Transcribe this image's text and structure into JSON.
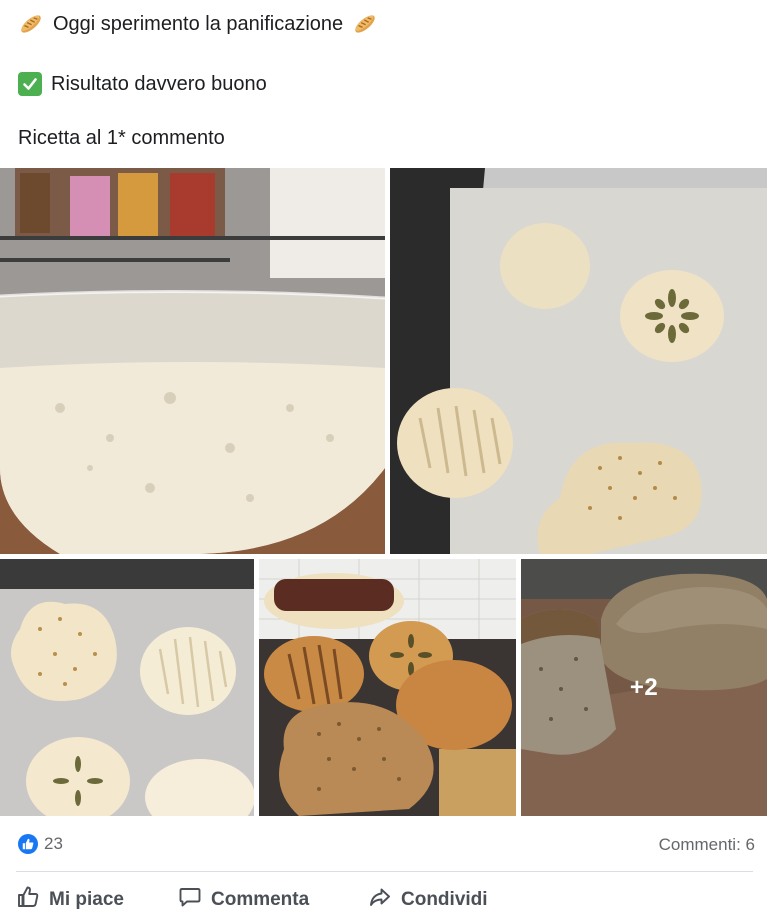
{
  "post": {
    "line1": "Oggi sperimento la panificazione",
    "line2": "Risultato davvero buono",
    "line3": "Ricetta al 1* commento"
  },
  "photos": {
    "more_count": "+2"
  },
  "footer": {
    "reactions_count": "23",
    "comments_label": "Commenti: 6"
  },
  "actions": {
    "like": "Mi piace",
    "comment": "Commenta",
    "share": "Condividi"
  },
  "icons": {
    "bread": "baguette-emoji",
    "check": "check-mark-emoji",
    "like": "thumbs-up-icon",
    "comment": "speech-bubble-icon",
    "share": "share-arrow-icon"
  },
  "colors": {
    "brand_blue": "#1877f2",
    "check_green": "#4caf50",
    "muted_text": "#65676b",
    "action_text": "#4b4f56"
  }
}
